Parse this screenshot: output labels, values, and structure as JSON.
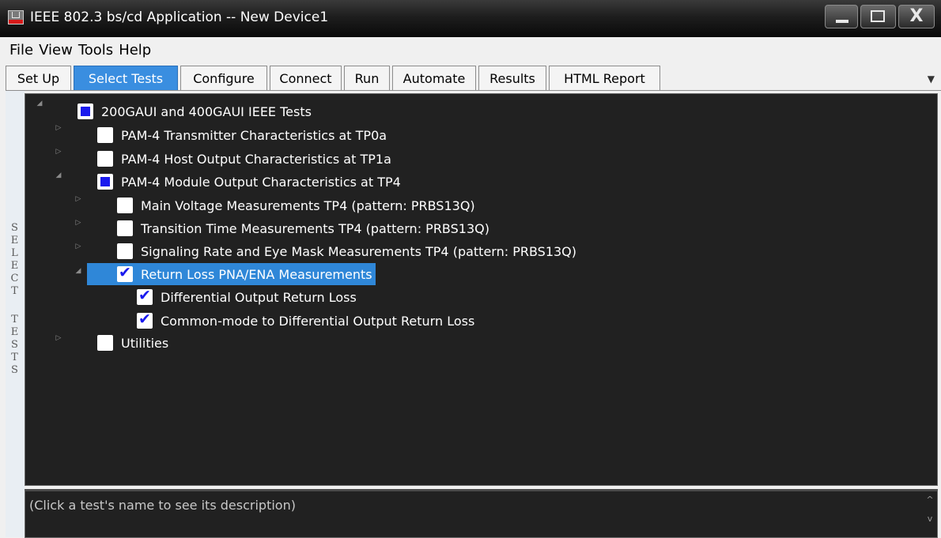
{
  "window": {
    "title": "IEEE 802.3 bs/cd Application -- New Device1",
    "close_glyph": "X"
  },
  "menu": [
    "File",
    "View",
    "Tools",
    "Help"
  ],
  "tabs": [
    "Set Up",
    "Select Tests",
    "Configure",
    "Connect",
    "Run",
    "Automate",
    "Results",
    "HTML Report"
  ],
  "active_tab": "Select Tests",
  "side_label": "SELECT TESTS",
  "tree": {
    "root": {
      "label": "200GAUI and 400GAUI IEEE Tests",
      "state": "partial",
      "expanded": true
    },
    "groups": [
      {
        "label": "PAM-4 Transmitter Characteristics at TP0a",
        "state": "unchecked",
        "expanded": false
      },
      {
        "label": "PAM-4 Host Output Characteristics at TP1a",
        "state": "unchecked",
        "expanded": false
      },
      {
        "label": "PAM-4 Module Output Characteristics at TP4",
        "state": "partial",
        "expanded": true
      }
    ],
    "tp4_children": [
      {
        "label": "Main Voltage Measurements TP4 (pattern: PRBS13Q)",
        "state": "unchecked",
        "expanded": false
      },
      {
        "label": "Transition Time Measurements TP4 (pattern: PRBS13Q)",
        "state": "unchecked",
        "expanded": false
      },
      {
        "label": "Signaling Rate and Eye Mask Measurements TP4 (pattern: PRBS13Q)",
        "state": "unchecked",
        "expanded": false
      },
      {
        "label": "Return Loss PNA/ENA Measurements",
        "state": "checked",
        "expanded": true,
        "selected": true
      }
    ],
    "return_loss_children": [
      {
        "label": "Differential Output Return Loss",
        "state": "checked"
      },
      {
        "label": "Common-mode to Differential Output Return Loss",
        "state": "checked"
      }
    ],
    "utilities": {
      "label": "Utilities",
      "state": "unchecked",
      "expanded": false
    }
  },
  "description": {
    "placeholder": "(Click a test's name to see its description)"
  },
  "icons": {
    "expand": "collapsed-triangle-icon",
    "collapse": "expanded-triangle-icon",
    "check": "checkmark-icon"
  },
  "colors": {
    "selection": "#2f87d8",
    "active_tab": "#3a8ee0",
    "partial_fill": "#1a1aee",
    "tree_background": "#212121"
  }
}
